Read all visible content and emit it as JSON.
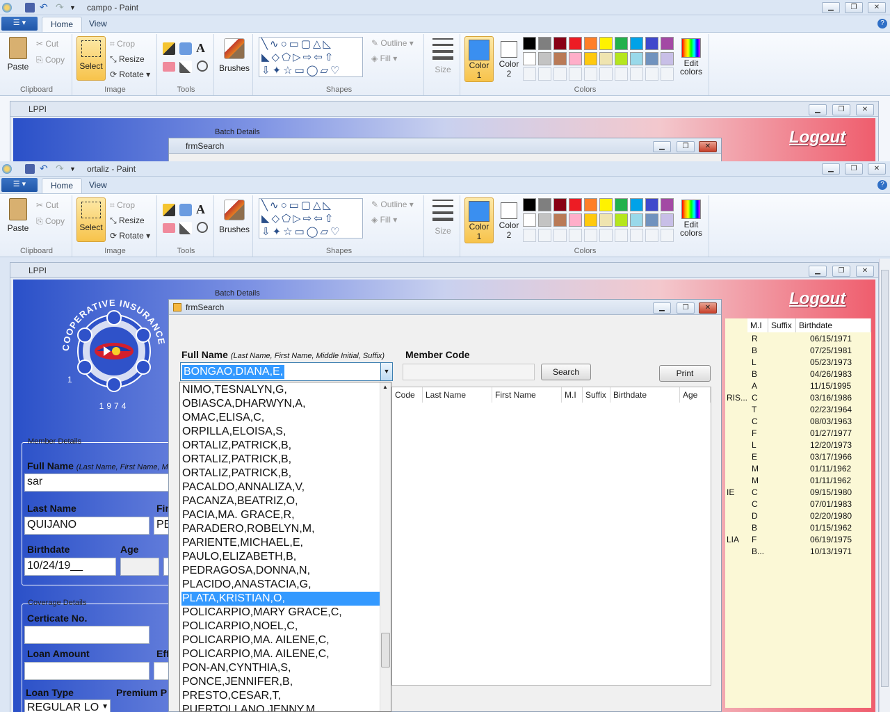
{
  "paint_top": {
    "title": "campo - Paint",
    "tabs": [
      "Home",
      "View"
    ],
    "clipboard": {
      "paste": "Paste",
      "cut": "Cut",
      "copy": "Copy",
      "group": "Clipboard"
    },
    "image": {
      "select": "Select",
      "crop": "Crop",
      "resize": "Resize",
      "rotate": "Rotate",
      "group": "Image"
    },
    "tools": {
      "group": "Tools"
    },
    "brushes": "Brushes",
    "shapes": {
      "outline": "Outline",
      "fill": "Fill",
      "group": "Shapes"
    },
    "size": "Size",
    "color1": {
      "label": "Color",
      "num": "1"
    },
    "color2": {
      "label": "Color",
      "num": "2"
    },
    "colors_group": "Colors",
    "edit_colors": "Edit colors"
  },
  "paint_bottom": {
    "title": "ortaliz - Paint"
  },
  "palette": {
    "row1": [
      "#000000",
      "#7f7f7f",
      "#880015",
      "#ed1c24",
      "#ff7f27",
      "#fff200",
      "#22b14c",
      "#00a2e8",
      "#3f48cc",
      "#a349a4"
    ],
    "row2": [
      "#ffffff",
      "#c3c3c3",
      "#b97a57",
      "#ffaec9",
      "#ffc90e",
      "#efe4b0",
      "#b5e61d",
      "#99d9ea",
      "#7092be",
      "#c8bfe7"
    ],
    "color1": "#3a8ff0",
    "color2": "#ffffff"
  },
  "lppi": {
    "title": "LPPI",
    "logout": "Logout",
    "batch_details": "Batch Details",
    "seal_text": "COOPERATIVE INSURANCE SYSTEM OF THE PHILIPPINES",
    "seal_year": "1974",
    "seal_num": "1",
    "member_details": "Member Details",
    "full_name_label": "Full Name",
    "full_name_hint": "(Last Name, First Name, Mi",
    "full_name_value": "sar",
    "last_name_label": "Last Name",
    "last_name_value": "QUIJANO",
    "first_label_cut": "Fir",
    "first_value_cut": "PE",
    "birthdate_label": "Birthdate",
    "birthdate_value": "10/24/19__",
    "age_label": "Age",
    "coverage_details": "Coverage Details",
    "certificate_label": "Certicate No.",
    "loan_amount_label": "Loan Amount",
    "eff_cut": "Eff",
    "loan_type_label": "Loan Type",
    "loan_type_value": "REGULAR LO",
    "premium_label": "Premium P"
  },
  "frm": {
    "title": "frmSearch",
    "full_name_label": "Full Name",
    "full_name_hint": "(Last Name, First Name, Middle Initial, Suffix)",
    "full_name_value": "BONGAO,DIANA,E,",
    "member_code_label": "Member Code",
    "search_button": "Search",
    "print_button": "Print",
    "columns": [
      "Code",
      "Last Name",
      "First Name",
      "M.I",
      "Suffix",
      "Birthdate",
      "Age"
    ]
  },
  "dropdown_items": [
    "NIMO,TESNALYN,G,",
    "OBIASCA,DHARWYN,A,",
    "OMAC,ELISA,C,",
    "ORPILLA,ELOISA,S,",
    "ORTALIZ,PATRICK,B,",
    "ORTALIZ,PATRICK,B,",
    "ORTALIZ,PATRICK,B,",
    "PACALDO,ANNALIZA,V,",
    "PACANZA,BEATRIZ,O,",
    "PACIA,MA. GRACE,R,",
    "PARADERO,ROBELYN,M,",
    "PARIENTE,MICHAEL,E,",
    "PAULO,ELIZABETH,B,",
    "PEDRAGOSA,DONNA,N,",
    "PLACIDO,ANASTACIA,G,",
    "PLATA,KRISTIAN,O,",
    "POLICARPIO,MARY GRACE,C,",
    "POLICARPIO,NOEL,C,",
    "POLICARPIO,MA. AILENE,C,",
    "POLICARPIO,MA. AILENE,C,",
    "PON-AN,CYNTHIA,S,",
    "PONCE,JENNIFER,B,",
    "PRESTO,CESAR,T,",
    "PUERTOLLANO,JENNY,M,"
  ],
  "selected_item": "PLATA,KRISTIAN,O,",
  "right_grid": {
    "headers": [
      "M.I",
      "Suffix",
      "Birthdate"
    ],
    "rows": [
      {
        "name": "",
        "mi": "R",
        "bd": "06/15/1971"
      },
      {
        "name": "",
        "mi": "B",
        "bd": "07/25/1981"
      },
      {
        "name": "",
        "mi": "L",
        "bd": "05/23/1973"
      },
      {
        "name": "",
        "mi": "B",
        "bd": "04/26/1983"
      },
      {
        "name": "",
        "mi": "A",
        "bd": "11/15/1995"
      },
      {
        "name": "RIS...",
        "mi": "C",
        "bd": "03/16/1986"
      },
      {
        "name": "",
        "mi": "T",
        "bd": "02/23/1964"
      },
      {
        "name": "",
        "mi": "C",
        "bd": "08/03/1963"
      },
      {
        "name": "",
        "mi": "F",
        "bd": "01/27/1977"
      },
      {
        "name": "",
        "mi": "L",
        "bd": "12/20/1973"
      },
      {
        "name": "",
        "mi": "E",
        "bd": "03/17/1966"
      },
      {
        "name": "",
        "mi": "M",
        "bd": "01/11/1962"
      },
      {
        "name": "",
        "mi": "M",
        "bd": "01/11/1962"
      },
      {
        "name": "IE",
        "mi": "C",
        "bd": "09/15/1980"
      },
      {
        "name": "",
        "mi": "C",
        "bd": "07/01/1983"
      },
      {
        "name": "",
        "mi": "D",
        "bd": "02/20/1980"
      },
      {
        "name": "",
        "mi": "B",
        "bd": "01/15/1962"
      },
      {
        "name": "LIA",
        "mi": "F",
        "bd": "06/19/1975"
      },
      {
        "name": "",
        "mi": "B...",
        "bd": "10/13/1971"
      }
    ]
  }
}
